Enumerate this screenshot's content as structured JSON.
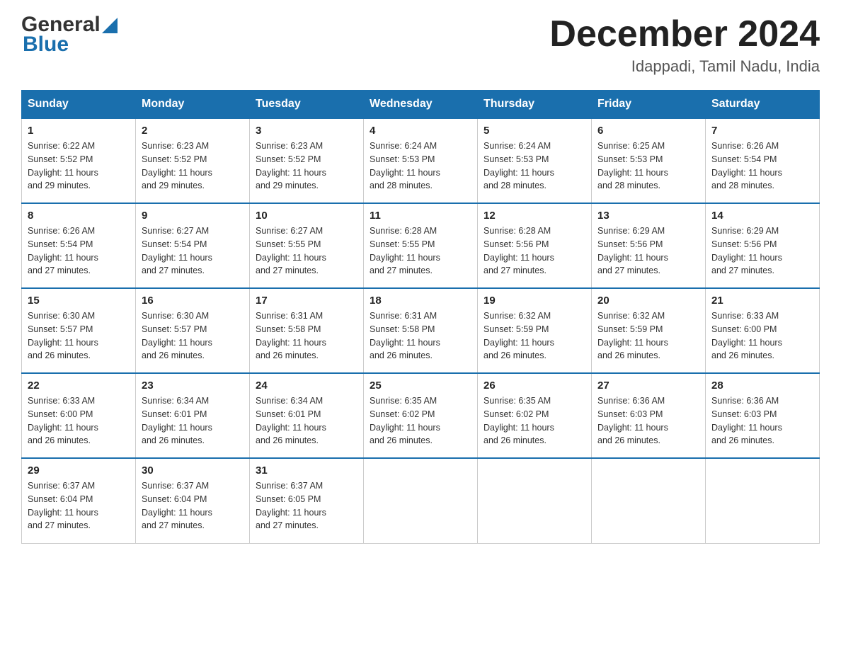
{
  "header": {
    "logo_general": "General",
    "logo_blue": "Blue",
    "month_title": "December 2024",
    "location": "Idappadi, Tamil Nadu, India"
  },
  "days_of_week": [
    "Sunday",
    "Monday",
    "Tuesday",
    "Wednesday",
    "Thursday",
    "Friday",
    "Saturday"
  ],
  "weeks": [
    [
      {
        "day": "1",
        "info": "Sunrise: 6:22 AM\nSunset: 5:52 PM\nDaylight: 11 hours\nand 29 minutes."
      },
      {
        "day": "2",
        "info": "Sunrise: 6:23 AM\nSunset: 5:52 PM\nDaylight: 11 hours\nand 29 minutes."
      },
      {
        "day": "3",
        "info": "Sunrise: 6:23 AM\nSunset: 5:52 PM\nDaylight: 11 hours\nand 29 minutes."
      },
      {
        "day": "4",
        "info": "Sunrise: 6:24 AM\nSunset: 5:53 PM\nDaylight: 11 hours\nand 28 minutes."
      },
      {
        "day": "5",
        "info": "Sunrise: 6:24 AM\nSunset: 5:53 PM\nDaylight: 11 hours\nand 28 minutes."
      },
      {
        "day": "6",
        "info": "Sunrise: 6:25 AM\nSunset: 5:53 PM\nDaylight: 11 hours\nand 28 minutes."
      },
      {
        "day": "7",
        "info": "Sunrise: 6:26 AM\nSunset: 5:54 PM\nDaylight: 11 hours\nand 28 minutes."
      }
    ],
    [
      {
        "day": "8",
        "info": "Sunrise: 6:26 AM\nSunset: 5:54 PM\nDaylight: 11 hours\nand 27 minutes."
      },
      {
        "day": "9",
        "info": "Sunrise: 6:27 AM\nSunset: 5:54 PM\nDaylight: 11 hours\nand 27 minutes."
      },
      {
        "day": "10",
        "info": "Sunrise: 6:27 AM\nSunset: 5:55 PM\nDaylight: 11 hours\nand 27 minutes."
      },
      {
        "day": "11",
        "info": "Sunrise: 6:28 AM\nSunset: 5:55 PM\nDaylight: 11 hours\nand 27 minutes."
      },
      {
        "day": "12",
        "info": "Sunrise: 6:28 AM\nSunset: 5:56 PM\nDaylight: 11 hours\nand 27 minutes."
      },
      {
        "day": "13",
        "info": "Sunrise: 6:29 AM\nSunset: 5:56 PM\nDaylight: 11 hours\nand 27 minutes."
      },
      {
        "day": "14",
        "info": "Sunrise: 6:29 AM\nSunset: 5:56 PM\nDaylight: 11 hours\nand 27 minutes."
      }
    ],
    [
      {
        "day": "15",
        "info": "Sunrise: 6:30 AM\nSunset: 5:57 PM\nDaylight: 11 hours\nand 26 minutes."
      },
      {
        "day": "16",
        "info": "Sunrise: 6:30 AM\nSunset: 5:57 PM\nDaylight: 11 hours\nand 26 minutes."
      },
      {
        "day": "17",
        "info": "Sunrise: 6:31 AM\nSunset: 5:58 PM\nDaylight: 11 hours\nand 26 minutes."
      },
      {
        "day": "18",
        "info": "Sunrise: 6:31 AM\nSunset: 5:58 PM\nDaylight: 11 hours\nand 26 minutes."
      },
      {
        "day": "19",
        "info": "Sunrise: 6:32 AM\nSunset: 5:59 PM\nDaylight: 11 hours\nand 26 minutes."
      },
      {
        "day": "20",
        "info": "Sunrise: 6:32 AM\nSunset: 5:59 PM\nDaylight: 11 hours\nand 26 minutes."
      },
      {
        "day": "21",
        "info": "Sunrise: 6:33 AM\nSunset: 6:00 PM\nDaylight: 11 hours\nand 26 minutes."
      }
    ],
    [
      {
        "day": "22",
        "info": "Sunrise: 6:33 AM\nSunset: 6:00 PM\nDaylight: 11 hours\nand 26 minutes."
      },
      {
        "day": "23",
        "info": "Sunrise: 6:34 AM\nSunset: 6:01 PM\nDaylight: 11 hours\nand 26 minutes."
      },
      {
        "day": "24",
        "info": "Sunrise: 6:34 AM\nSunset: 6:01 PM\nDaylight: 11 hours\nand 26 minutes."
      },
      {
        "day": "25",
        "info": "Sunrise: 6:35 AM\nSunset: 6:02 PM\nDaylight: 11 hours\nand 26 minutes."
      },
      {
        "day": "26",
        "info": "Sunrise: 6:35 AM\nSunset: 6:02 PM\nDaylight: 11 hours\nand 26 minutes."
      },
      {
        "day": "27",
        "info": "Sunrise: 6:36 AM\nSunset: 6:03 PM\nDaylight: 11 hours\nand 26 minutes."
      },
      {
        "day": "28",
        "info": "Sunrise: 6:36 AM\nSunset: 6:03 PM\nDaylight: 11 hours\nand 26 minutes."
      }
    ],
    [
      {
        "day": "29",
        "info": "Sunrise: 6:37 AM\nSunset: 6:04 PM\nDaylight: 11 hours\nand 27 minutes."
      },
      {
        "day": "30",
        "info": "Sunrise: 6:37 AM\nSunset: 6:04 PM\nDaylight: 11 hours\nand 27 minutes."
      },
      {
        "day": "31",
        "info": "Sunrise: 6:37 AM\nSunset: 6:05 PM\nDaylight: 11 hours\nand 27 minutes."
      },
      {
        "day": "",
        "info": ""
      },
      {
        "day": "",
        "info": ""
      },
      {
        "day": "",
        "info": ""
      },
      {
        "day": "",
        "info": ""
      }
    ]
  ]
}
